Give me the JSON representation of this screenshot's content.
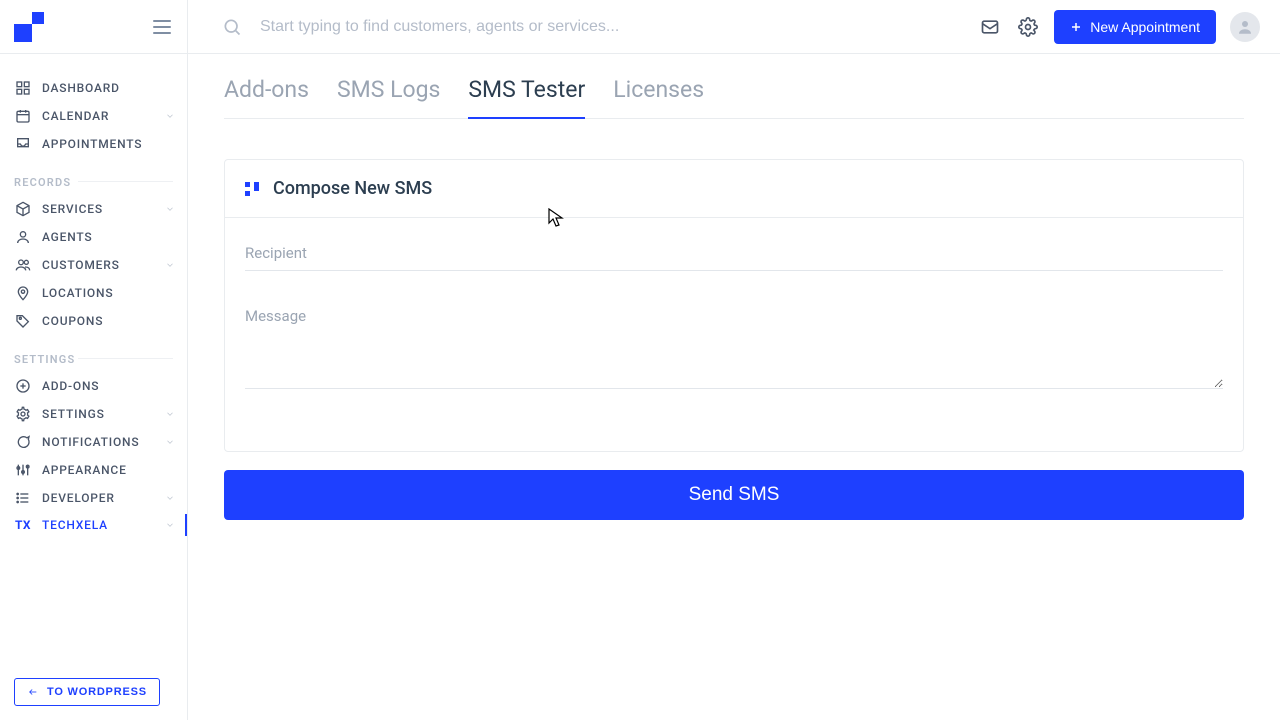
{
  "header": {
    "search_placeholder": "Start typing to find customers, agents or services...",
    "new_appointment_label": "New Appointment"
  },
  "sidebar": {
    "main": [
      {
        "label": "DASHBOARD",
        "icon": "dashboard-icon",
        "chev": false
      },
      {
        "label": "CALENDAR",
        "icon": "calendar-icon",
        "chev": true
      },
      {
        "label": "APPOINTMENTS",
        "icon": "inbox-icon",
        "chev": false
      }
    ],
    "section_records": "RECORDS",
    "records": [
      {
        "label": "SERVICES",
        "icon": "cube-icon",
        "chev": true
      },
      {
        "label": "AGENTS",
        "icon": "user-icon",
        "chev": false
      },
      {
        "label": "CUSTOMERS",
        "icon": "users-icon",
        "chev": true
      },
      {
        "label": "LOCATIONS",
        "icon": "pin-icon",
        "chev": false
      },
      {
        "label": "COUPONS",
        "icon": "tag-icon",
        "chev": false
      }
    ],
    "section_settings": "SETTINGS",
    "settings": [
      {
        "label": "ADD-ONS",
        "icon": "plus-circle-icon",
        "chev": false
      },
      {
        "label": "SETTINGS",
        "icon": "gear-icon",
        "chev": true
      },
      {
        "label": "NOTIFICATIONS",
        "icon": "chat-icon",
        "chev": true
      },
      {
        "label": "APPEARANCE",
        "icon": "sliders-icon",
        "chev": false
      },
      {
        "label": "DEVELOPER",
        "icon": "list-icon",
        "chev": true
      },
      {
        "label": "TECHXELA",
        "icon": "tx-icon",
        "chev": true
      }
    ],
    "back_label": "TO WORDPRESS"
  },
  "tabs": [
    {
      "label": "Add-ons",
      "active": false
    },
    {
      "label": "SMS Logs",
      "active": false
    },
    {
      "label": "SMS Tester",
      "active": true
    },
    {
      "label": "Licenses",
      "active": false
    }
  ],
  "card": {
    "title": "Compose New SMS",
    "recipient_placeholder": "Recipient",
    "message_placeholder": "Message"
  },
  "send_button_label": "Send SMS"
}
